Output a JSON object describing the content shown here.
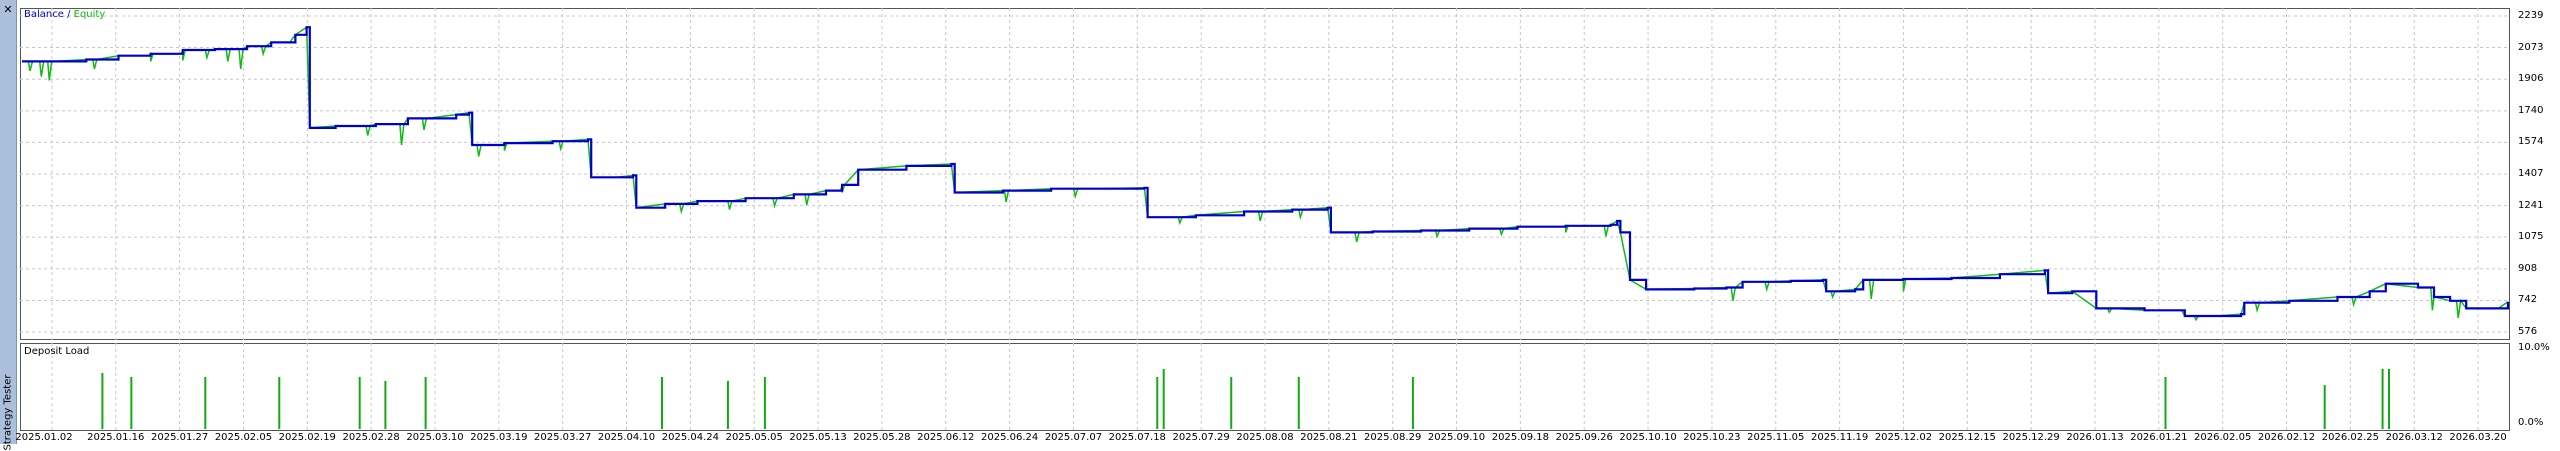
{
  "window": {
    "side_label": "Strategy Tester",
    "close_glyph": "✕"
  },
  "legend": {
    "balance": "Balance",
    "separator": " / ",
    "equity": "Equity"
  },
  "deposit_panel": {
    "title": "Deposit Load"
  },
  "colors": {
    "balance": "#0000cc",
    "equity": "#11bb11",
    "deposit": "#11aa11",
    "grid": "#c8c8c8",
    "frame": "#555555"
  },
  "chart_data": [
    {
      "type": "line",
      "title": "",
      "series_labels": [
        "Balance",
        "Equity"
      ],
      "y_ticks": [
        "2239",
        "2073",
        "1906",
        "1740",
        "1574",
        "1407",
        "1241",
        "1075",
        "908",
        "742",
        "576"
      ],
      "ylim": [
        576,
        2239
      ],
      "x_ticks": [
        "2025.01.02",
        "2025.01.16",
        "2025.01.27",
        "2025.02.05",
        "2025.02.19",
        "2025.02.28",
        "2025.03.10",
        "2025.03.19",
        "2025.03.27",
        "2025.04.10",
        "2025.04.24",
        "2025.05.05",
        "2025.05.13",
        "2025.05.28",
        "2025.06.12",
        "2025.06.24",
        "2025.07.07",
        "2025.07.18",
        "2025.07.29",
        "2025.08.08",
        "2025.08.21",
        "2025.08.29",
        "2025.09.10",
        "2025.09.18",
        "2025.09.26",
        "2025.10.10",
        "2025.10.23",
        "2025.11.05",
        "2025.11.19",
        "2025.12.02",
        "2025.12.15",
        "2025.12.29",
        "2026.01.13",
        "2026.01.21",
        "2026.02.05",
        "2026.02.12",
        "2026.02.25",
        "2026.03.12",
        "2026.03.20"
      ],
      "balance": [
        [
          0,
          2000
        ],
        [
          20,
          2000
        ],
        [
          40,
          2010
        ],
        [
          60,
          2030
        ],
        [
          80,
          2040
        ],
        [
          100,
          2060
        ],
        [
          120,
          2065
        ],
        [
          140,
          2080
        ],
        [
          155,
          2100
        ],
        [
          170,
          2140
        ],
        [
          177,
          2180
        ],
        [
          179,
          1650
        ],
        [
          195,
          1660
        ],
        [
          220,
          1670
        ],
        [
          240,
          1700
        ],
        [
          270,
          1720
        ],
        [
          278,
          1730
        ],
        [
          280,
          1560
        ],
        [
          300,
          1570
        ],
        [
          330,
          1580
        ],
        [
          352,
          1590
        ],
        [
          354,
          1390
        ],
        [
          370,
          1390
        ],
        [
          380,
          1400
        ],
        [
          382,
          1230
        ],
        [
          400,
          1250
        ],
        [
          420,
          1265
        ],
        [
          450,
          1280
        ],
        [
          480,
          1300
        ],
        [
          500,
          1320
        ],
        [
          510,
          1350
        ],
        [
          520,
          1430
        ],
        [
          550,
          1450
        ],
        [
          578,
          1460
        ],
        [
          580,
          1310
        ],
        [
          610,
          1320
        ],
        [
          640,
          1330
        ],
        [
          670,
          1330
        ],
        [
          698,
          1335
        ],
        [
          700,
          1180
        ],
        [
          730,
          1190
        ],
        [
          760,
          1210
        ],
        [
          790,
          1220
        ],
        [
          812,
          1230
        ],
        [
          814,
          1100
        ],
        [
          840,
          1105
        ],
        [
          870,
          1110
        ],
        [
          900,
          1120
        ],
        [
          930,
          1130
        ],
        [
          960,
          1135
        ],
        [
          988,
          1140
        ],
        [
          992,
          1160
        ],
        [
          994,
          1100
        ],
        [
          1000,
          850
        ],
        [
          1010,
          800
        ],
        [
          1040,
          805
        ],
        [
          1060,
          810
        ],
        [
          1070,
          840
        ],
        [
          1100,
          845
        ],
        [
          1120,
          850
        ],
        [
          1122,
          790
        ],
        [
          1140,
          800
        ],
        [
          1145,
          850
        ],
        [
          1170,
          855
        ],
        [
          1200,
          860
        ],
        [
          1230,
          880
        ],
        [
          1258,
          900
        ],
        [
          1260,
          780
        ],
        [
          1275,
          790
        ],
        [
          1290,
          700
        ],
        [
          1320,
          690
        ],
        [
          1343,
          690
        ],
        [
          1345,
          660
        ],
        [
          1365,
          660
        ],
        [
          1380,
          670
        ],
        [
          1382,
          730
        ],
        [
          1410,
          740
        ],
        [
          1440,
          760
        ],
        [
          1460,
          790
        ],
        [
          1470,
          830
        ],
        [
          1490,
          810
        ],
        [
          1500,
          760
        ],
        [
          1510,
          740
        ],
        [
          1520,
          700
        ],
        [
          1540,
          700
        ],
        [
          1546,
          735
        ]
      ],
      "equity_dips": [
        [
          5,
          1950
        ],
        [
          12,
          1920
        ],
        [
          17,
          1900
        ],
        [
          45,
          1960
        ],
        [
          80,
          2000
        ],
        [
          100,
          2005
        ],
        [
          115,
          2020
        ],
        [
          128,
          2000
        ],
        [
          136,
          1960
        ],
        [
          150,
          2040
        ],
        [
          165,
          2100
        ],
        [
          215,
          1610
        ],
        [
          236,
          1560
        ],
        [
          250,
          1640
        ],
        [
          284,
          1500
        ],
        [
          300,
          1530
        ],
        [
          335,
          1540
        ],
        [
          410,
          1210
        ],
        [
          440,
          1220
        ],
        [
          468,
          1240
        ],
        [
          488,
          1245
        ],
        [
          510,
          1310
        ],
        [
          612,
          1260
        ],
        [
          655,
          1290
        ],
        [
          720,
          1150
        ],
        [
          770,
          1160
        ],
        [
          795,
          1180
        ],
        [
          830,
          1050
        ],
        [
          880,
          1080
        ],
        [
          920,
          1090
        ],
        [
          960,
          1100
        ],
        [
          985,
          1080
        ],
        [
          1064,
          740
        ],
        [
          1085,
          800
        ],
        [
          1126,
          760
        ],
        [
          1150,
          750
        ],
        [
          1170,
          790
        ],
        [
          1298,
          680
        ],
        [
          1352,
          640
        ],
        [
          1390,
          690
        ],
        [
          1450,
          720
        ],
        [
          1499,
          690
        ],
        [
          1515,
          650
        ]
      ],
      "series": [
        {
          "values_ref": "balance"
        },
        {
          "values_ref": "equity_dips"
        }
      ]
    },
    {
      "type": "bar",
      "title": "Deposit Load",
      "y_ticks": [
        "10.0%",
        "0.0%"
      ],
      "ylim": [
        0,
        10
      ],
      "x": [
        50,
        68,
        114,
        160,
        210,
        226,
        251,
        398,
        439,
        462,
        706,
        710,
        752,
        794,
        865,
        1333,
        1432,
        1468,
        1472
      ],
      "values": [
        7.0,
        6.5,
        6.5,
        6.5,
        6.5,
        6.0,
        6.5,
        6.5,
        6.0,
        6.5,
        6.5,
        7.5,
        6.5,
        6.5,
        6.5,
        6.5,
        5.5,
        7.5,
        7.5
      ]
    }
  ]
}
